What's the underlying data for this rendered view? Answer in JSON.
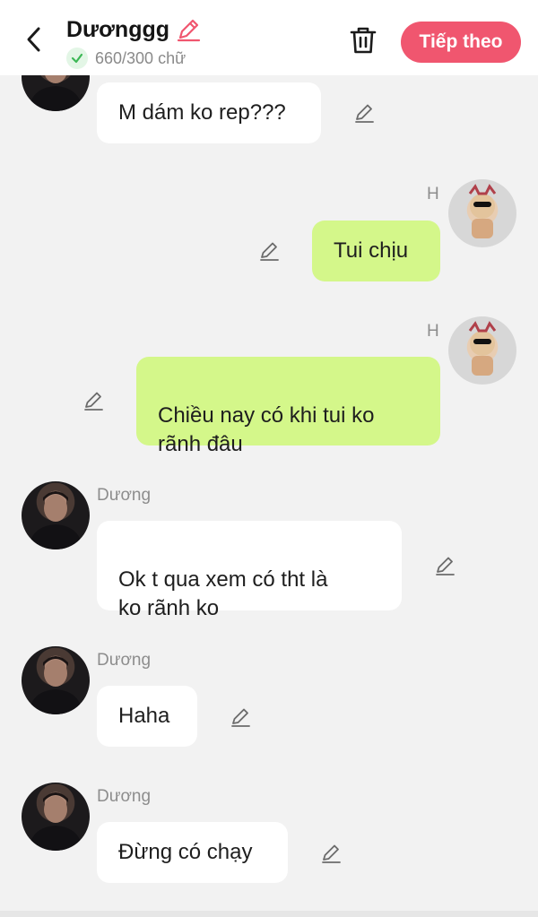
{
  "header": {
    "title": "Dươnggg",
    "char_count": "660/300 chữ",
    "next_label": "Tiếp theo",
    "accent_color": "#f0566f"
  },
  "messages": [
    {
      "side": "in",
      "sender": "",
      "text": "M dám ko rep???"
    },
    {
      "side": "out",
      "sender": "H",
      "text": "Tui chịu"
    },
    {
      "side": "out",
      "sender": "H",
      "text": "Chiều nay có khi tui ko\nrãnh đâu"
    },
    {
      "side": "in",
      "sender": "Dương",
      "text": "Ok t qua xem có tht là\nko rãnh ko"
    },
    {
      "side": "in",
      "sender": "Dương",
      "text": "Haha"
    },
    {
      "side": "in",
      "sender": "Dương",
      "text": "Đừng có chạy"
    }
  ],
  "icons": {
    "back": "chevron-left-icon",
    "title_edit": "pencil-icon",
    "check": "check-circle-icon",
    "delete": "trash-icon",
    "message_edit": "pencil-icon"
  }
}
